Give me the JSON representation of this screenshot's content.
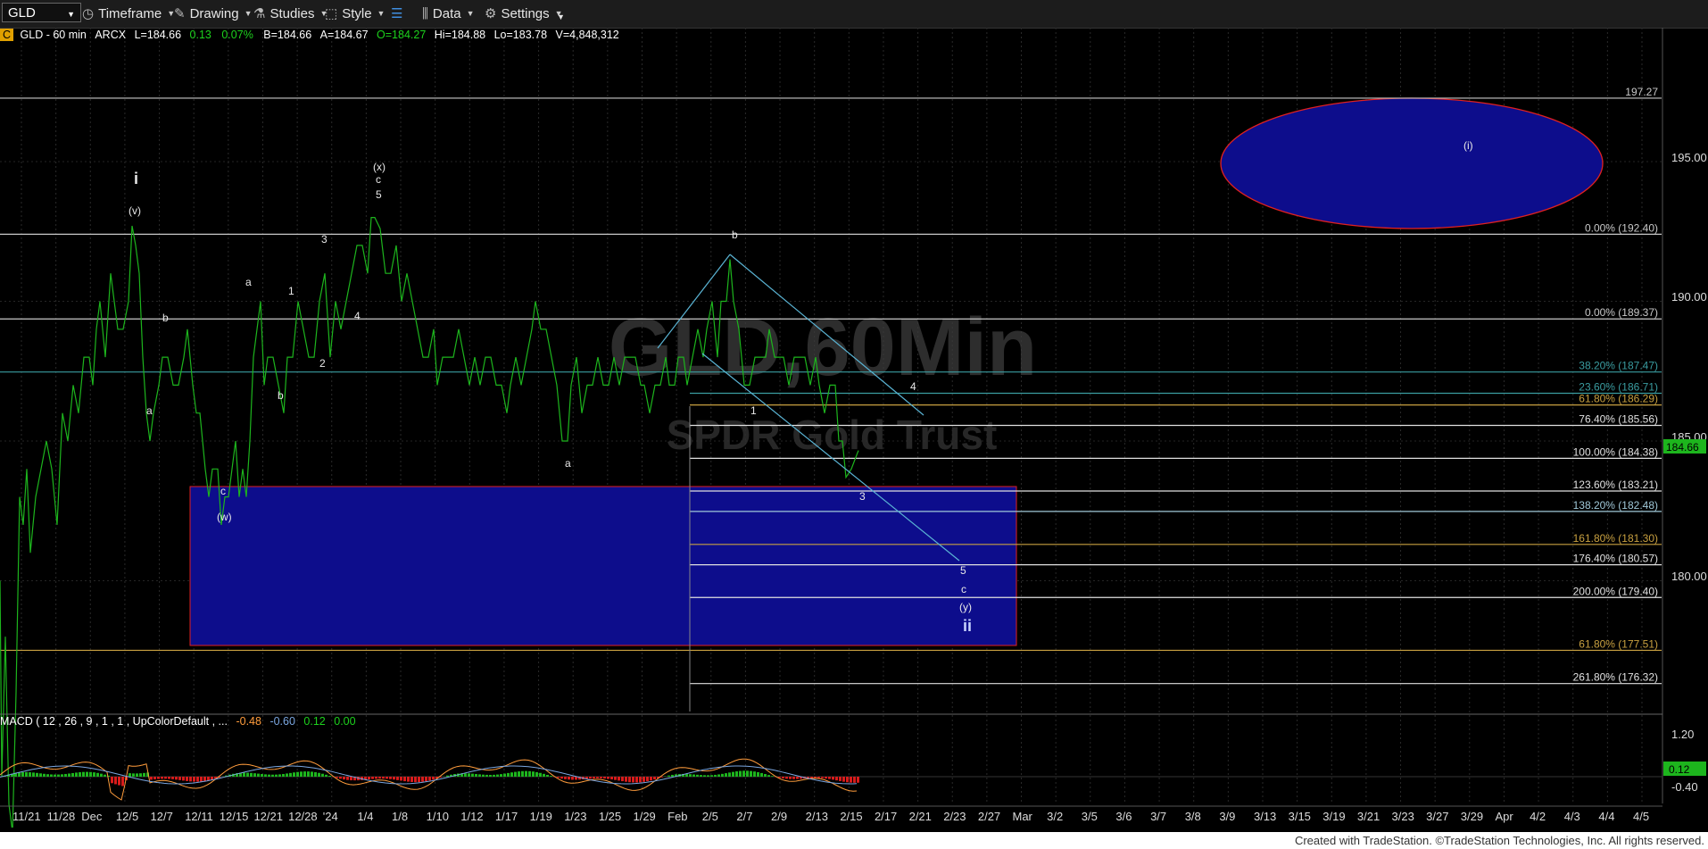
{
  "toolbar": {
    "symbol": "GLD",
    "timeframe": "Timeframe",
    "drawing": "Drawing",
    "studies": "Studies",
    "style": "Style",
    "data": "Data",
    "settings": "Settings"
  },
  "info": {
    "badge": "C",
    "symbol": "GLD - 60 min",
    "exchange": "ARCX",
    "last": "L=184.66",
    "change": "0.13",
    "pct": "0.07%",
    "bid": "B=184.66",
    "ask": "A=184.67",
    "open": "O=184.27",
    "high": "Hi=184.88",
    "low": "Lo=183.78",
    "volume": "V=4,848,312"
  },
  "watermark": {
    "title": "GLD,60Min",
    "subtitle": "SPDR Gold Trust"
  },
  "macd": {
    "label": "MACD ( 12 , 26 , 9 , 1 , 1 , UpColorDefault , ...",
    "v1": "-0.48",
    "v2": "-0.60",
    "v3": "0.12",
    "v4": "0.00"
  },
  "price_axis": [
    "195.00",
    "190.00",
    "185.00",
    "180.00"
  ],
  "last_price": "184.66",
  "macd_axis": [
    "1.20",
    "-0.40"
  ],
  "macd_current": "0.12",
  "fib_levels": [
    {
      "label": "197.27",
      "price": 197.27,
      "color": "#c8c8c8"
    },
    {
      "label": "0.00% (192.40)",
      "price": 192.4,
      "color": "#c8c8c8"
    },
    {
      "label": "0.00% (189.37)",
      "price": 189.37,
      "color": "#c8c8c8"
    },
    {
      "label": "38.20% (187.47)",
      "price": 187.47,
      "color": "#3a9ca0"
    },
    {
      "label": "23.60% (186.71)",
      "price": 186.71,
      "color": "#3a9ca0"
    },
    {
      "label": "61.80% (186.29)",
      "price": 186.29,
      "color": "#c8a040"
    },
    {
      "label": "76.40% (185.56)",
      "price": 185.56,
      "color": "#e0e0e0"
    },
    {
      "label": "100.00% (184.38)",
      "price": 184.38,
      "color": "#e0e0e0"
    },
    {
      "label": "123.60% (183.21)",
      "price": 183.21,
      "color": "#e0e0e0"
    },
    {
      "label": "138.20% (182.48)",
      "price": 182.48,
      "color": "#a0c8d8"
    },
    {
      "label": "161.80% (181.30)",
      "price": 181.3,
      "color": "#c8a040"
    },
    {
      "label": "176.40% (180.57)",
      "price": 180.57,
      "color": "#e0e0e0"
    },
    {
      "label": "200.00% (179.40)",
      "price": 179.4,
      "color": "#e0e0e0"
    },
    {
      "label": "61.80% (177.51)",
      "price": 177.51,
      "color": "#c8a040"
    },
    {
      "label": "261.80% (176.32)",
      "price": 176.32,
      "color": "#e0e0e0"
    }
  ],
  "date_axis": [
    "11/21",
    "11/28",
    "Dec",
    "12/5",
    "12/7",
    "12/11",
    "12/15",
    "12/21",
    "12/28",
    "'24",
    "1/4",
    "1/8",
    "1/10",
    "1/12",
    "1/17",
    "1/19",
    "1/23",
    "1/25",
    "1/29",
    "Feb",
    "2/5",
    "2/7",
    "2/9",
    "2/13",
    "2/15",
    "2/17",
    "2/21",
    "2/23",
    "2/27",
    "Mar",
    "3/2",
    "3/5",
    "3/6",
    "3/7",
    "3/8",
    "3/9",
    "3/13",
    "3/15",
    "3/19",
    "3/21",
    "3/23",
    "3/27",
    "3/29",
    "Apr",
    "4/2",
    "4/3",
    "4/4",
    "4/5"
  ],
  "wave_labels": {
    "i": "i",
    "v": "(v)",
    "b1": "b",
    "a1": "a",
    "c1": "c",
    "w": "(w)",
    "a2": "a",
    "b2": "b",
    "one": "1",
    "two": "2",
    "three": "3",
    "four": "4",
    "x": "(x)",
    "c2": "c",
    "five": "5",
    "a3": "a",
    "b3": "b",
    "w1": "1",
    "w3": "3",
    "w4": "4",
    "w5": "5",
    "c3": "c",
    "y": "(y)",
    "ii": "ii",
    "target": "(i)"
  },
  "colors": {
    "bull": "#1db51d",
    "target_zone": "#0d0d8c",
    "zone_border": "#e02020",
    "channel": "#5ab4d4"
  },
  "footer": "Created with TradeStation. ©TradeStation Technologies, Inc. All rights reserved."
}
